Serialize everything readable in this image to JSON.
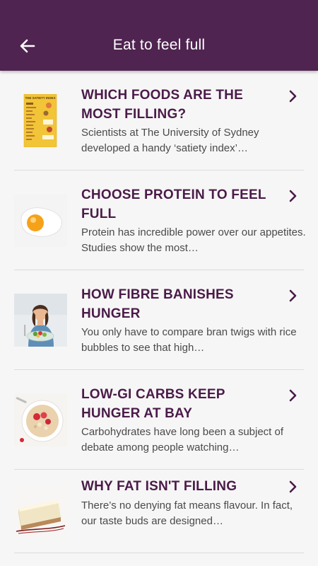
{
  "header": {
    "title": "Eat to feel full",
    "back_icon": "arrow-left-icon"
  },
  "colors": {
    "appbar": "#4f2450",
    "title_text": "#4a1b49",
    "body_text": "#4a4a4a",
    "background": "#f7f6f6"
  },
  "articles": [
    {
      "title": "WHICH FOODS ARE THE MOST FILLING?",
      "description": "Scientists at The University of Sydney developed a handy ‘satiety index’…",
      "thumbnail": "satiety-index-chart-image",
      "thumbnail_text": "THE SATIETY INDEX"
    },
    {
      "title": "CHOOSE PROTEIN TO FEEL FULL",
      "description": "Protein has incredible power over our appetites. Studies show the most…",
      "thumbnail": "fried-egg-image"
    },
    {
      "title": "HOW FIBRE BANISHES HUNGER",
      "description": "You only have to compare bran twigs with rice bubbles to see that high…",
      "thumbnail": "woman-with-salad-image"
    },
    {
      "title": "LOW-GI CARBS KEEP HUNGER AT BAY",
      "description": "Carbohydrates have long been a subject of debate among people watching…",
      "thumbnail": "porridge-bowl-image"
    },
    {
      "title": "WHY FAT ISN'T FILLING",
      "description": "There’s no denying fat means flavour. In fact, our taste buds are designed…",
      "thumbnail": "cheesecake-slice-image"
    }
  ]
}
